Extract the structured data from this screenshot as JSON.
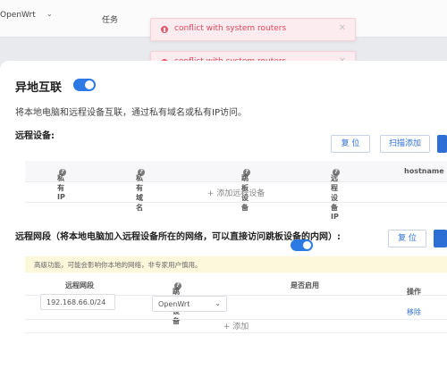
{
  "topbar": {
    "brand": "OpenWrt",
    "nav_task": "任务"
  },
  "toasts": [
    {
      "message": "conflict with system routers"
    },
    {
      "message": "conflict with system routers"
    }
  ],
  "section": {
    "title": "异地互联",
    "enabled": true,
    "description": "将本地电脑和远程设备互联，通过私有域名或私有IP访问。"
  },
  "remote_devices": {
    "heading": "远程设备:",
    "reset_label": "复 位",
    "scan_add_label": "扫描添加",
    "columns": [
      "私有IP",
      "私有域名",
      "跳板设备",
      "远程设备IP",
      "hostname"
    ],
    "add_label": "+ 添加远程设备"
  },
  "remote_networks": {
    "heading": "远程网段（将本地电脑加入远程设备所在的网络，可以直接访问跳板设备的内网）:",
    "reset_label": "复 位",
    "warning": "高级功能，可能会影响你本地的网络，非专家用户慎用。",
    "columns": [
      "远程网段",
      "跳板设备",
      "是否启用",
      "操作"
    ],
    "rows": [
      {
        "subnet": "192.168.66.0/24",
        "jump_device": "OpenWrt",
        "enabled": true,
        "action": "移除"
      }
    ],
    "add_label": "+ 添加"
  },
  "colors": {
    "accent": "#2e7ae5",
    "error": "#e0475d",
    "warning_bg": "#fdf7dc"
  }
}
